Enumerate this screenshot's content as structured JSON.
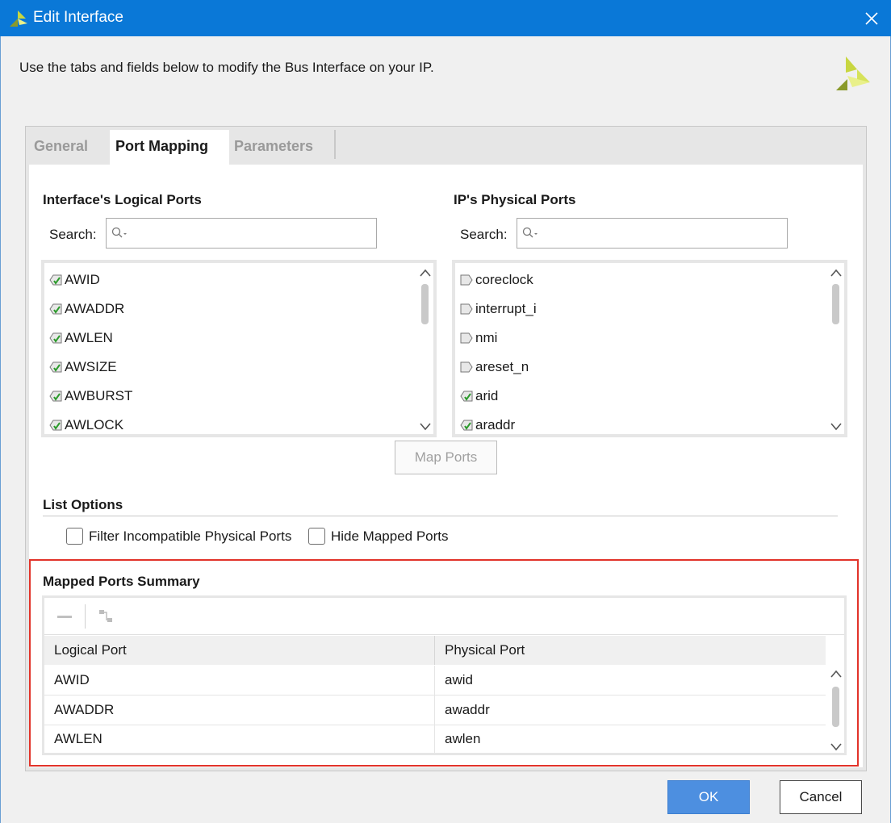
{
  "window": {
    "title": "Edit Interface",
    "intro": "Use the tabs and fields below to modify the Bus Interface on your IP."
  },
  "tabs": [
    {
      "label": "General"
    },
    {
      "label": "Port Mapping"
    },
    {
      "label": "Parameters"
    }
  ],
  "logical": {
    "title": "Interface's Logical Ports",
    "search_label": "Search:",
    "items": [
      "AWID",
      "AWADDR",
      "AWLEN",
      "AWSIZE",
      "AWBURST",
      "AWLOCK"
    ]
  },
  "physical": {
    "title": "IP's Physical Ports",
    "search_label": "Search:",
    "items": [
      {
        "name": "coreclock",
        "mapped": false
      },
      {
        "name": "interrupt_i",
        "mapped": false
      },
      {
        "name": "nmi",
        "mapped": false
      },
      {
        "name": "areset_n",
        "mapped": false
      },
      {
        "name": "arid",
        "mapped": true
      },
      {
        "name": "araddr",
        "mapped": true
      }
    ]
  },
  "map_ports_label": "Map Ports",
  "list_options": {
    "title": "List Options",
    "filter_label": "Filter Incompatible Physical Ports",
    "filter_checked": false,
    "hide_label": "Hide Mapped Ports",
    "hide_checked": false
  },
  "summary": {
    "title": "Mapped Ports Summary",
    "columns": [
      "Logical Port",
      "Physical Port"
    ],
    "rows": [
      {
        "logical": "AWID",
        "physical": "awid"
      },
      {
        "logical": "AWADDR",
        "physical": "awaddr"
      },
      {
        "logical": "AWLEN",
        "physical": "awlen"
      }
    ]
  },
  "footer": {
    "ok_label": "OK",
    "cancel_label": "Cancel"
  },
  "colors": {
    "titlebar": "#0a78d7",
    "highlight": "#e2332a",
    "ok_button": "#4d8fe0"
  }
}
